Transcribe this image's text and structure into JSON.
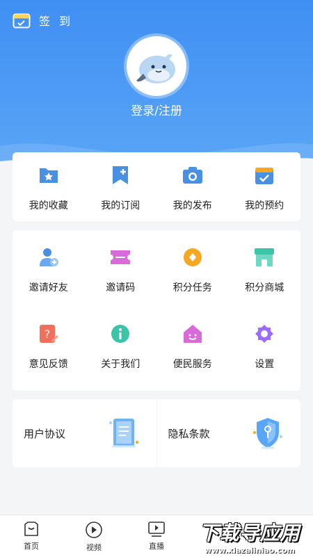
{
  "header": {
    "signin_label": "签 到",
    "login_label": "登录/注册"
  },
  "colors": {
    "header_blue": "#3f8ff3",
    "accent_blue": "#4a90e2",
    "orange": "#f5a623",
    "pink": "#f06292",
    "purple": "#9c6bff",
    "green": "#3cc4a8"
  },
  "quick_actions": [
    {
      "label": "我的收藏",
      "icon": "folder-star-icon"
    },
    {
      "label": "我的订阅",
      "icon": "bookmark-plus-icon"
    },
    {
      "label": "我的发布",
      "icon": "camera-icon"
    },
    {
      "label": "我的预约",
      "icon": "calendar-check-icon"
    }
  ],
  "services": [
    {
      "label": "邀请好友",
      "icon": "add-user-icon"
    },
    {
      "label": "邀请码",
      "icon": "ticket-icon"
    },
    {
      "label": "积分任务",
      "icon": "coin-icon"
    },
    {
      "label": "积分商城",
      "icon": "store-icon"
    },
    {
      "label": "意见反馈",
      "icon": "feedback-icon"
    },
    {
      "label": "关于我们",
      "icon": "info-icon"
    },
    {
      "label": "便民服务",
      "icon": "home-smile-icon"
    },
    {
      "label": "设置",
      "icon": "gear-icon"
    }
  ],
  "agreements": [
    {
      "label": "用户协议",
      "icon": "document-icon"
    },
    {
      "label": "隐私条款",
      "icon": "shield-key-icon"
    }
  ],
  "tabbar": [
    {
      "label": "首页",
      "icon": "home-icon"
    },
    {
      "label": "视频",
      "icon": "play-circle-icon"
    },
    {
      "label": "直播",
      "icon": "tv-play-icon"
    }
  ],
  "watermark": {
    "main": "下载导应用",
    "sub": "www.xiazaiiniao.com"
  }
}
